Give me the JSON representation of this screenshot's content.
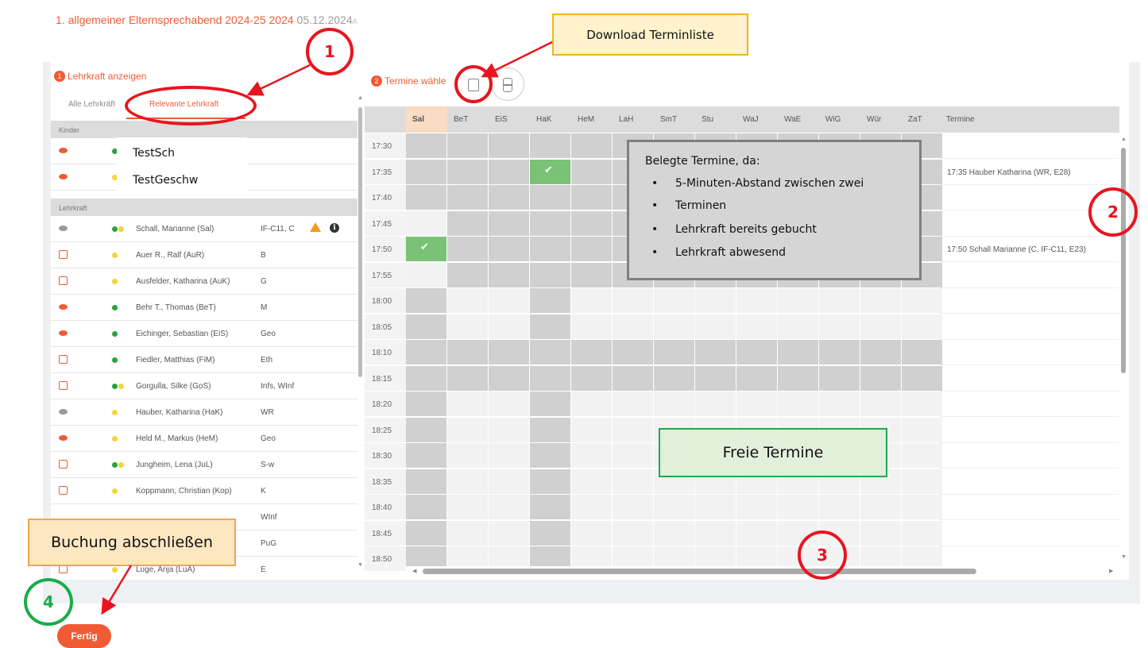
{
  "header": {
    "title": "1. allgemeiner Elternsprechabend 2024-25 2024",
    "date": "05.12.2024",
    "date_cut": "A"
  },
  "left": {
    "step_num": "1",
    "step_label": "Lehrkraft anzeigen",
    "tab_all": "Alle Lehrkräft",
    "tab_relevant": "Relevante Lehrkraft",
    "section_kinder": "Kinder",
    "section_lehrkraft": "Lehrkraft",
    "kinder": [
      "TestSch",
      "TestGeschw"
    ],
    "teachers": [
      {
        "name": "Schall, Marianne (Sal)",
        "subjects": "IF-C11, C"
      },
      {
        "name": "Auer R., Ralf (AuR)",
        "subjects": "B"
      },
      {
        "name": "Ausfelder, Katharina (AuK)",
        "subjects": "G"
      },
      {
        "name": "Behr T., Thomas (BeT)",
        "subjects": "M"
      },
      {
        "name": "Eichinger, Sebastian (EiS)",
        "subjects": "Geo"
      },
      {
        "name": "Fiedler, Matthias (FiM)",
        "subjects": "Eth"
      },
      {
        "name": "Gorgulla, Silke (GoS)",
        "subjects": "Infs, WInf"
      },
      {
        "name": "Hauber, Katharina (HaK)",
        "subjects": "WR"
      },
      {
        "name": "Held M., Markus (HeM)",
        "subjects": "Geo"
      },
      {
        "name": "Jungheim, Lena (JuL)",
        "subjects": "S-w"
      },
      {
        "name": "Koppmann, Christian (Kop)",
        "subjects": "K"
      },
      {
        "name": "",
        "subjects": "WInf"
      },
      {
        "name": "",
        "subjects": "PuG"
      },
      {
        "name": "Luge, Anja (LuA)",
        "subjects": "E"
      }
    ]
  },
  "right": {
    "step_num": "2",
    "step_label": "Termine wähle",
    "columns": [
      "Sal",
      "BeT",
      "EiS",
      "HaK",
      "HeM",
      "LaH",
      "SmT",
      "Stu",
      "WaJ",
      "WaE",
      "WiG",
      "Wür",
      "ZaT"
    ],
    "termine_header": "Termine",
    "times": [
      "17:30",
      "17:35",
      "17:40",
      "17:45",
      "17:50",
      "17:55",
      "18:00",
      "18:05",
      "18:10",
      "18:15",
      "18:20",
      "18:25",
      "18:30",
      "18:35",
      "18:40",
      "18:45",
      "18:50"
    ],
    "termine": {
      "1": "17:35 Hauber Katharina (WR, E28)",
      "4": "17:50 Schall Marianne (C, IF-C11, E23)"
    },
    "check_glyph": "✔"
  },
  "annotations": {
    "download_label": "Download Terminliste",
    "busy_title": "Belegte Termine, da:",
    "busy_bullets": [
      "5-Minuten-Abstand zwischen zwei",
      "Terminen",
      "Lehrkraft bereits gebucht",
      "Lehrkraft abwesend"
    ],
    "free_label": "Freie Termine",
    "booking_label": "Buchung abschließen",
    "n1": "1",
    "n2": "2",
    "n3": "3",
    "n4": "4"
  },
  "footer": {
    "done_button": "Fertig"
  },
  "colors": {
    "accent": "#f05a35",
    "booked": "#79c276",
    "busy": "#d0d0d0",
    "annotation_red": "#e8141f"
  }
}
